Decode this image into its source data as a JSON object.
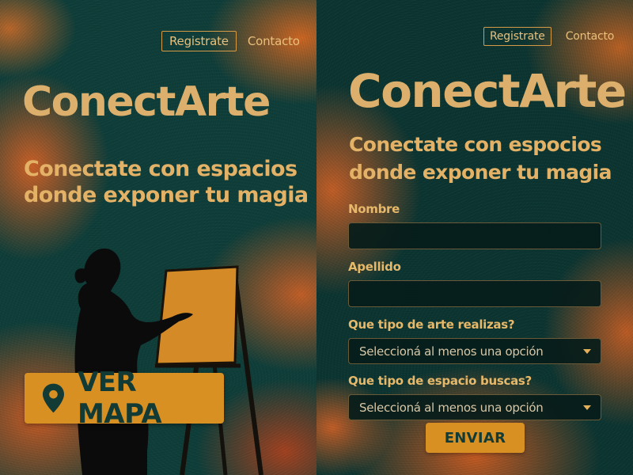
{
  "left": {
    "nav": {
      "register": "Registrate",
      "contact": "Contacto"
    },
    "brand": "ConectArte",
    "tagline": "Conectate con espacios donde exponer tu magia",
    "map_button": {
      "label": "VER MAPA",
      "icon": "map-pin-icon"
    },
    "illustration": "artist-painting-silhouette"
  },
  "right": {
    "nav": {
      "register": "Registrate",
      "contact": "Contacto"
    },
    "brand": "ConectArte",
    "tagline_line1": "Conectate con espocios",
    "tagline_line2": "donde exponer tu magia",
    "form": {
      "first_name_label": "Nombre",
      "first_name_value": "",
      "last_name_label": "Apellido",
      "last_name_value": "",
      "art_type_label": "Que tipo de arte realizas?",
      "art_type_placeholder": "Seleccioná al menos una opción",
      "space_type_label": "Que tipo de espacio buscas?",
      "space_type_placeholder": "Seleccioná al menos una opción",
      "submit_label": "ENVIAR"
    }
  },
  "colors": {
    "teal": "#0f3e3a",
    "orange": "#d4622a",
    "gold_text": "#dcb06c",
    "button": "#d99022"
  }
}
